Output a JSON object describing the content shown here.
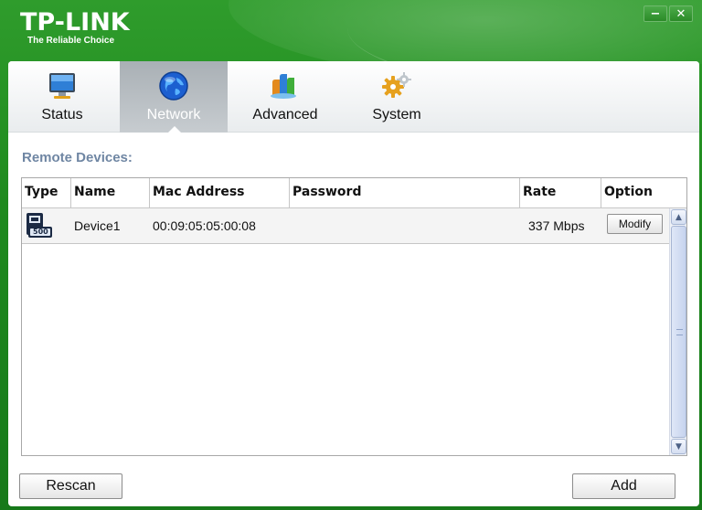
{
  "app": {
    "brand": "TP-LINK",
    "tagline": "The Reliable Choice",
    "minimize_glyph": "−",
    "close_glyph": "✕"
  },
  "tabs": [
    {
      "label": "Status",
      "icon": "monitor-icon",
      "active": false
    },
    {
      "label": "Network",
      "icon": "globe-icon",
      "active": true
    },
    {
      "label": "Advanced",
      "icon": "chart-icon",
      "active": false
    },
    {
      "label": "System",
      "icon": "gear-icon",
      "active": false
    }
  ],
  "section_title": "Remote Devices:",
  "table": {
    "columns": [
      "Type",
      "Name",
      "Mac Address",
      "Password",
      "Rate",
      "Option"
    ],
    "rows": [
      {
        "type_icon": "powerline-device-icon",
        "type_icon_text": "500",
        "name": "Device1",
        "mac": "00:09:05:05:00:08",
        "password": "",
        "rate": "337 Mbps",
        "option": "Modify"
      }
    ]
  },
  "buttons": {
    "rescan": "Rescan",
    "add": "Add"
  },
  "colors": {
    "brand_green": "#1f8a1e",
    "section_title": "#6f86a3",
    "active_tab": "#b6bcc1"
  }
}
